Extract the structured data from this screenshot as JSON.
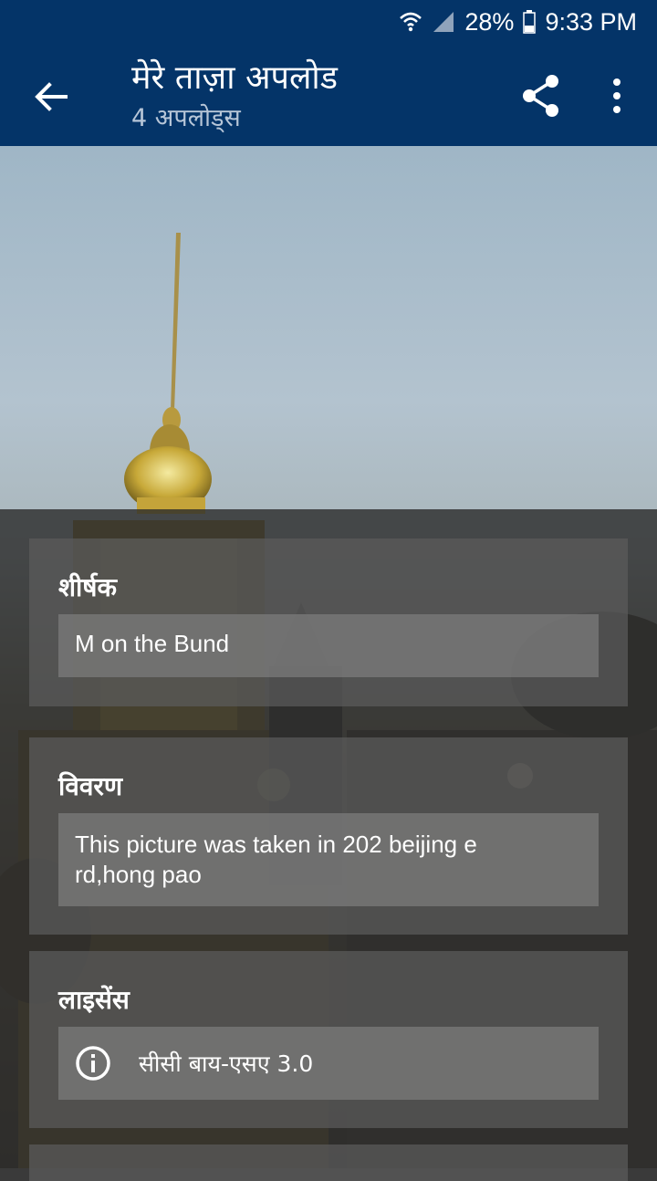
{
  "status_bar": {
    "battery": "28%",
    "time": "9:33 PM",
    "icons": [
      "wifi-icon",
      "signal-icon",
      "battery-icon"
    ]
  },
  "app_bar": {
    "title": "मेरे ताज़ा अपलोड",
    "subtitle": "4 अपलोड्स",
    "icons": [
      "back-arrow-icon",
      "share-icon",
      "more-vert-icon"
    ]
  },
  "details": {
    "title_section": {
      "label": "शीर्षक",
      "value": "M on the Bund"
    },
    "description_section": {
      "label": "विवरण",
      "value_line1": "This picture was taken in 202 beijing e",
      "value_line2": "rd,hong pao"
    },
    "license_section": {
      "label": "लाइसेंस",
      "value": "सीसी बाय-एसए 3.0",
      "icon": "info-icon"
    }
  },
  "colors": {
    "app_bar": "#043468",
    "subtitle": "#b7c6d8"
  }
}
